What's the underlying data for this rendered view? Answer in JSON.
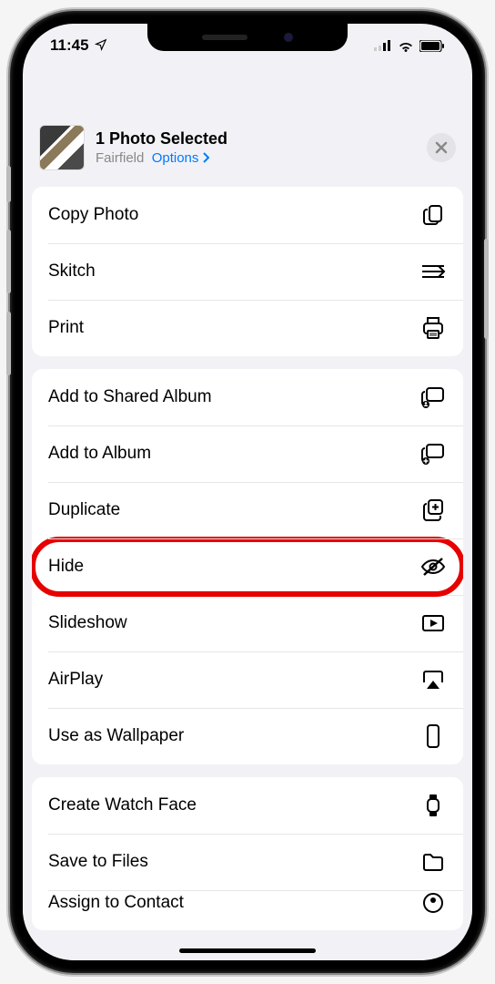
{
  "status": {
    "time": "11:45",
    "location_icon": "location-arrow"
  },
  "sheet": {
    "title": "1 Photo Selected",
    "location": "Fairfield",
    "options_label": "Options",
    "close_label": "×"
  },
  "groups": [
    {
      "items": [
        {
          "label": "Copy Photo",
          "icon": "copy-icon",
          "highlighted": false
        },
        {
          "label": "Skitch",
          "icon": "skitch-icon",
          "highlighted": false
        },
        {
          "label": "Print",
          "icon": "print-icon",
          "highlighted": false
        }
      ]
    },
    {
      "items": [
        {
          "label": "Add to Shared Album",
          "icon": "shared-album-icon",
          "highlighted": false
        },
        {
          "label": "Add to Album",
          "icon": "add-album-icon",
          "highlighted": false
        },
        {
          "label": "Duplicate",
          "icon": "duplicate-icon",
          "highlighted": false
        },
        {
          "label": "Hide",
          "icon": "hide-icon",
          "highlighted": true
        },
        {
          "label": "Slideshow",
          "icon": "slideshow-icon",
          "highlighted": false
        },
        {
          "label": "AirPlay",
          "icon": "airplay-icon",
          "highlighted": false
        },
        {
          "label": "Use as Wallpaper",
          "icon": "wallpaper-icon",
          "highlighted": false
        }
      ]
    },
    {
      "items": [
        {
          "label": "Create Watch Face",
          "icon": "watch-icon",
          "highlighted": false
        },
        {
          "label": "Save to Files",
          "icon": "folder-icon",
          "highlighted": false
        },
        {
          "label": "Assign to Contact",
          "icon": "contact-icon",
          "highlighted": false
        }
      ]
    }
  ]
}
